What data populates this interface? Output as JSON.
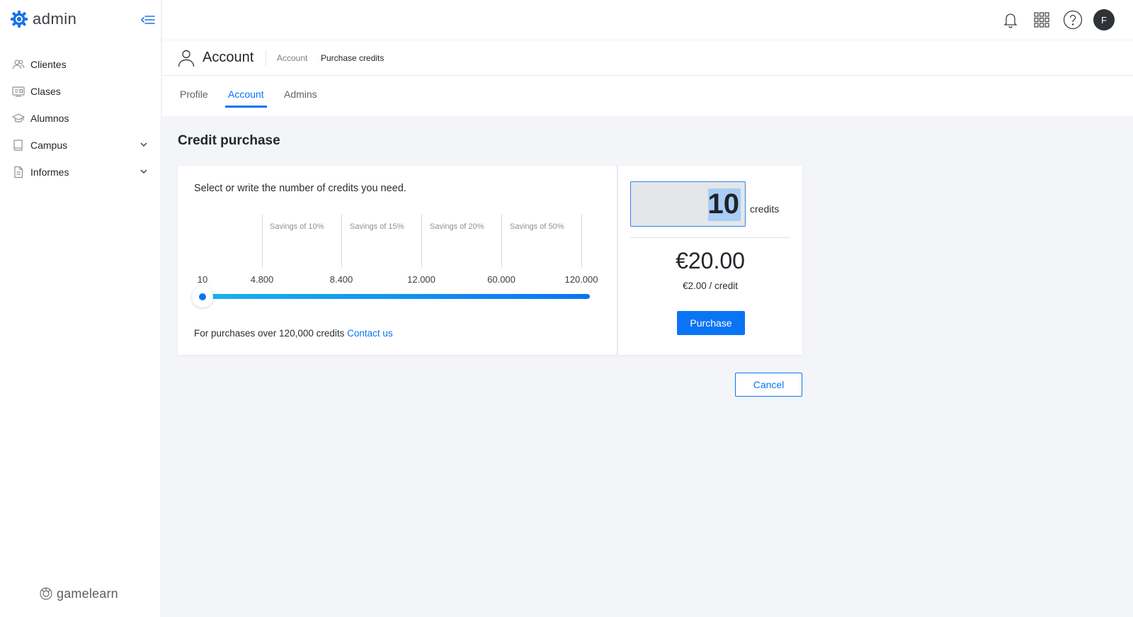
{
  "app": {
    "logo_text": "admin",
    "brand_text": "gamelearn"
  },
  "sidebar": {
    "items": [
      {
        "label": "Clientes",
        "icon": "users-icon"
      },
      {
        "label": "Clases",
        "icon": "class-icon"
      },
      {
        "label": "Alumnos",
        "icon": "graduation-cap-icon"
      },
      {
        "label": "Campus",
        "icon": "book-icon",
        "expandable": true
      },
      {
        "label": "Informes",
        "icon": "document-icon",
        "expandable": true
      }
    ]
  },
  "topbar": {
    "avatar_initial": "F"
  },
  "header": {
    "title": "Account",
    "breadcrumb": [
      "Account",
      "Purchase credits"
    ]
  },
  "tabs": [
    {
      "label": "Profile",
      "active": false
    },
    {
      "label": "Account",
      "active": true
    },
    {
      "label": "Admins",
      "active": false
    }
  ],
  "main": {
    "section_title": "Credit purchase",
    "instruction": "Select or write the number of credits you need.",
    "tiers": [
      "Savings of 10%",
      "Savings of 15%",
      "Savings of 20%",
      "Savings of 50%"
    ],
    "ticks": [
      "10",
      "4.800",
      "8.400",
      "12.000",
      "60.000",
      "120.000"
    ],
    "slider_value": 10,
    "footnote": "For purchases over 120,000 credits",
    "contact_link": "Contact us",
    "credits_value": "10",
    "credits_unit": "credits",
    "price": "€20.00",
    "unit_price": "€2.00 / credit",
    "purchase_label": "Purchase",
    "cancel_label": "Cancel"
  },
  "colors": {
    "accent": "#0a74f5",
    "gradient_start": "#19b3f0",
    "background": "#f4f5f9"
  }
}
